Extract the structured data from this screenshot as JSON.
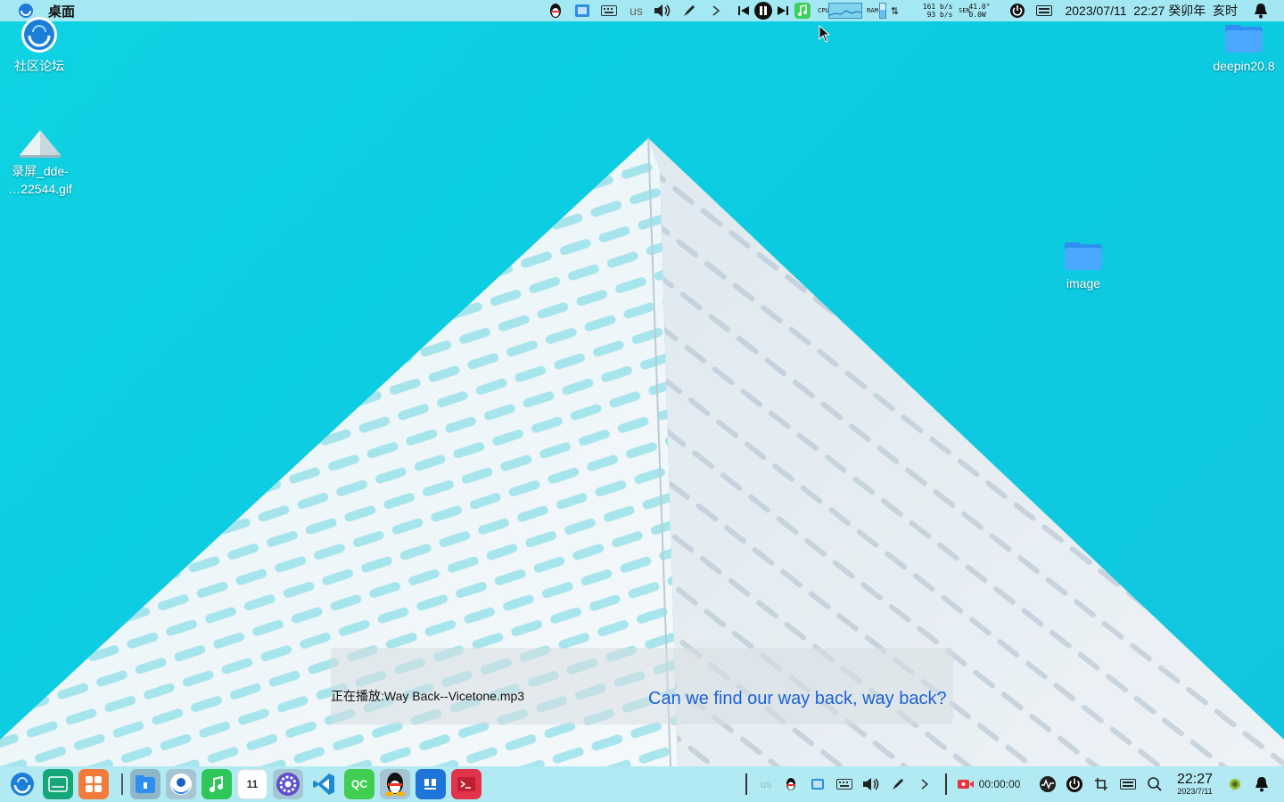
{
  "top_panel": {
    "active_app": "桌面",
    "keyboard_layout": "us",
    "cpu_label": "CPU",
    "ram_label": "RAM",
    "net_up": "161 b/s",
    "net_down": "93 b/s",
    "sen_label": "SEN",
    "temperature": "41.0°",
    "power": "0.0W",
    "datetime": "2023/07/11  22:27 癸卯年  亥时"
  },
  "desktop": {
    "icons": [
      {
        "label": "社区论坛",
        "icon": "deepin-forum-icon"
      },
      {
        "label": "录屏_dde-\n…22544.gif",
        "icon": "gif-file-icon"
      },
      {
        "label": "deepin20.8",
        "icon": "folder-icon"
      },
      {
        "label": "image",
        "icon": "folder-icon"
      }
    ]
  },
  "lyrics": {
    "now_playing": "正在播放:Way Back--Vicetone.mp3",
    "line": "Can we find our way back, way back?"
  },
  "dock": {
    "apps": [
      {
        "name": "launcher",
        "icon": "deepin-launcher-icon"
      },
      {
        "name": "terminal-manager",
        "icon": "green-app-icon"
      },
      {
        "name": "app-store",
        "icon": "app-store-icon"
      },
      {
        "name": "file-manager",
        "icon": "file-manager-icon"
      },
      {
        "name": "browser",
        "icon": "browser-icon"
      },
      {
        "name": "music",
        "icon": "music-icon"
      },
      {
        "name": "calendar",
        "icon": "calendar-icon",
        "text": "11"
      },
      {
        "name": "settings",
        "icon": "settings-icon"
      },
      {
        "name": "vscode",
        "icon": "vscode-icon"
      },
      {
        "name": "qt-creator",
        "icon": "qt-creator-icon",
        "text": "QC"
      },
      {
        "name": "qq",
        "icon": "qq-icon"
      },
      {
        "name": "notes",
        "icon": "notes-icon"
      },
      {
        "name": "terminal",
        "icon": "terminal-icon"
      }
    ],
    "keyboard_layout": "us",
    "record_time": "00:00:00",
    "clock_time": "22:27",
    "clock_date": "2023/7/11"
  },
  "colors": {
    "lyric_text": "#1d62d6",
    "wallpaper": "#0fd2e3",
    "panel": "#beecf4"
  }
}
